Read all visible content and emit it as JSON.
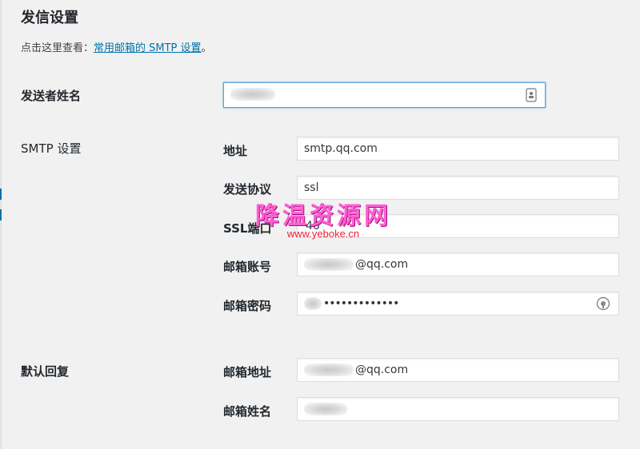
{
  "page_title": "发信设置",
  "intro": {
    "prefix": "点击这里查看：",
    "link": "常用邮箱的 SMTP 设置",
    "suffix": "。"
  },
  "sender_name": {
    "label": "发送者姓名",
    "value": ""
  },
  "smtp": {
    "section_label": "SMTP 设置",
    "address_label": "地址",
    "address_value": "smtp.qq.com",
    "protocol_label": "发送协议",
    "protocol_value": "ssl",
    "port_label": "SSL端口",
    "port_value": "46",
    "account_label": "邮箱账号",
    "account_value": "@qq.com",
    "password_label": "邮箱密码",
    "password_value": "•••••••••••••"
  },
  "reply": {
    "section_label": "默认回复",
    "email_label": "邮箱地址",
    "email_value": "@qq.com",
    "name_label": "邮箱姓名",
    "name_value": ""
  },
  "watermark": {
    "text": "降温资源网",
    "url": "www.yeboke.cn"
  },
  "icons": {
    "sender_field_icon": "contact-card-icon",
    "password_field_icon": "password-eye-icon"
  },
  "colors": {
    "link": "#0073aa",
    "focus_border": "#5b9dd9",
    "watermark": "#ff5fd4"
  }
}
